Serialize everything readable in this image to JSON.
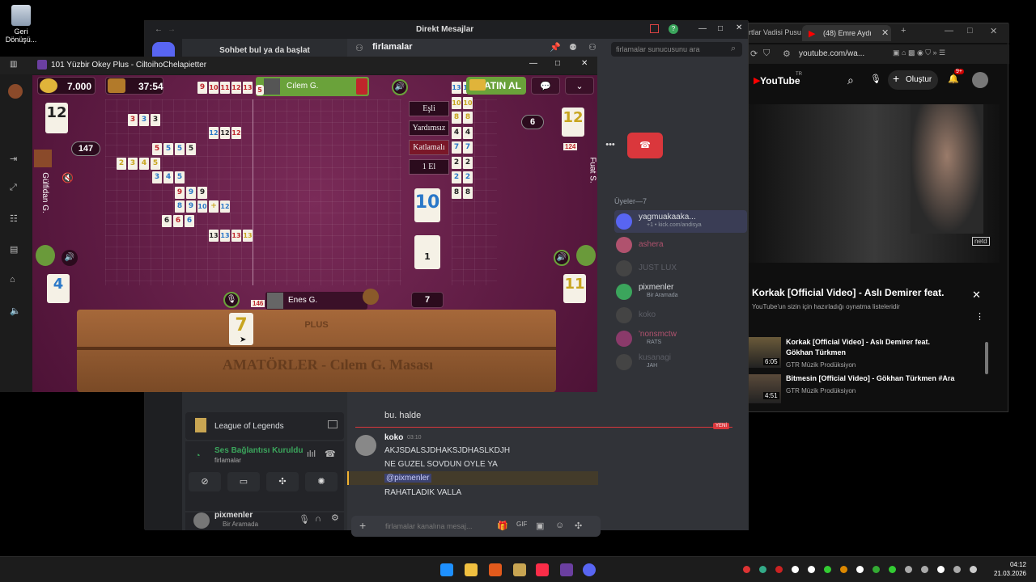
{
  "desktop": {
    "recycle_bin_label": "Geri Dönüşü..."
  },
  "discord": {
    "title": "Direkt Mesajlar",
    "find_conversation": "Sohbet bul ya da başlat",
    "channel_name": "firlamalar",
    "search_placeholder": "firlamalar sunucusunu ara",
    "members_header": "Üyeler—7",
    "members": [
      {
        "name": "yagmuakaaka...",
        "status": "+1 • kick.com/andisya",
        "color": "#dbdee1"
      },
      {
        "name": "ashera",
        "status": "",
        "color": "#b0526e"
      },
      {
        "name": "JUST LUX",
        "status": "",
        "color": "#5c5e66"
      },
      {
        "name": "pixmenler",
        "status": "Bir Aramada",
        "color": "#dbdee1"
      },
      {
        "name": "koko",
        "status": "",
        "color": "#5c5e66"
      },
      {
        "name": "'nonsmctw",
        "status": "RATS",
        "color": "#b0526e"
      },
      {
        "name": "kusanagi",
        "status": "JAH",
        "color": "#5c5e66"
      }
    ],
    "messages": [
      {
        "author": "",
        "time": "",
        "text": "bu. halde"
      },
      {
        "author": "koko",
        "time": "03:10",
        "text": "AKJSDALSJDHAKSJDHASLKDJH"
      },
      {
        "author": "",
        "time": "",
        "text": "NE GUZEL SOVDUN OYLE YA"
      },
      {
        "author": "",
        "time": "",
        "text": "@pixmenler"
      },
      {
        "author": "",
        "time": "",
        "text": "RAHATLADIK VALLA"
      }
    ],
    "new_badge": "YENİ",
    "activity_game": "League of Legends",
    "voice_status": "Ses Bağlantısı Kuruldu",
    "voice_channel": "firlamalar",
    "user_name": "pixmenler",
    "user_status": "Bir Aramada",
    "composer_placeholder": "firlamalar kanalına mesaj..."
  },
  "youtube": {
    "tab1": "rtlar Vadisi Pusu",
    "tab2": "(48) Emre Aydı",
    "url": "youtube.com/wa...",
    "create_label": "Oluştur",
    "notif_count": "9+",
    "logo": "YouTube",
    "logo_sup": "TR",
    "video_watermark": "netd",
    "playlist_title": "Korkak [Official Video] - Aslı Demirer feat.",
    "playlist_sub": "YouTube'un sizin için hazırladığı oynatma listeleridir",
    "items": [
      {
        "title": "Korkak [Official Video] - Aslı Demirer feat. Gökhan Türkmen",
        "channel": "GTR Müzik Prodüksiyon",
        "duration": "6:05"
      },
      {
        "title": "Bitmesin [Official Video] - Gökhan Türkmen #Ara",
        "channel": "GTR Müzik Prodüksiyon",
        "duration": "4:51"
      }
    ]
  },
  "game": {
    "window_title": "101 Yüzbir Okey Plus - CiltoihoChelapietter",
    "gold": "7.000",
    "chest": "37:54",
    "top_player": "Cılem G.",
    "top_player_tile": "5",
    "buy_label": "SATIN AL",
    "left_player": "Gülfidan G.",
    "right_player": "Fuat S.",
    "bottom_player": "Enes G.",
    "bottom_player_tiles": "146",
    "right_player_tiles": "124",
    "left_score_top": "12",
    "left_score_mid": "147",
    "left_score_bottom": "4",
    "right_score_top": "12",
    "right_score_mid": "6",
    "right_score_bottom": "11",
    "center_tile": "10",
    "deck_count": "1",
    "discard_count": "7",
    "rack_tile": "7",
    "options": [
      "Eşli",
      "Yardımsız",
      "Katlamalı",
      "1 El"
    ],
    "rack_watermark": "AMATÖRLER - Cılem G. Masası",
    "rack_logo": "PLUS",
    "melds": [
      [
        {
          "v": "9",
          "c": "r"
        },
        {
          "v": "10",
          "c": "r"
        },
        {
          "v": "11",
          "c": "r"
        },
        {
          "v": "12",
          "c": "r"
        },
        {
          "v": "13",
          "c": "r"
        }
      ],
      [
        {
          "v": "3",
          "c": "r"
        },
        {
          "v": "3",
          "c": "b"
        },
        {
          "v": "3",
          "c": "k"
        }
      ],
      [
        {
          "v": "12",
          "c": "b"
        },
        {
          "v": "12",
          "c": "k"
        },
        {
          "v": "12",
          "c": "r"
        }
      ],
      [
        {
          "v": "5",
          "c": "r"
        },
        {
          "v": "5",
          "c": "b"
        },
        {
          "v": "5",
          "c": "b"
        },
        {
          "v": "5",
          "c": "k"
        }
      ],
      [
        {
          "v": "2",
          "c": "y"
        },
        {
          "v": "3",
          "c": "y"
        },
        {
          "v": "4",
          "c": "y"
        },
        {
          "v": "5",
          "c": "y"
        }
      ],
      [
        {
          "v": "3",
          "c": "b"
        },
        {
          "v": "4",
          "c": "b"
        },
        {
          "v": "5",
          "c": "b"
        }
      ],
      [
        {
          "v": "9",
          "c": "r"
        },
        {
          "v": "9",
          "c": "b"
        },
        {
          "v": "9",
          "c": "k"
        }
      ],
      [
        {
          "v": "8",
          "c": "b"
        },
        {
          "v": "9",
          "c": "b"
        },
        {
          "v": "10",
          "c": "b"
        },
        {
          "v": "+",
          "c": "y"
        },
        {
          "v": "12",
          "c": "b"
        }
      ],
      [
        {
          "v": "6",
          "c": "k"
        },
        {
          "v": "6",
          "c": "r"
        },
        {
          "v": "6",
          "c": "b"
        }
      ],
      [
        {
          "v": "13",
          "c": "k"
        },
        {
          "v": "13",
          "c": "b"
        },
        {
          "v": "13",
          "c": "r"
        },
        {
          "v": "13",
          "c": "y"
        }
      ]
    ],
    "right_melds": [
      [
        {
          "v": "13",
          "c": "b"
        },
        {
          "v": "13",
          "c": "b"
        }
      ],
      [
        {
          "v": "10",
          "c": "y"
        },
        {
          "v": "10",
          "c": "y"
        }
      ],
      [
        {
          "v": "8",
          "c": "y"
        },
        {
          "v": "8",
          "c": "y"
        }
      ],
      [
        {
          "v": "4",
          "c": "k"
        },
        {
          "v": "4",
          "c": "k"
        }
      ],
      [
        {
          "v": "7",
          "c": "b"
        },
        {
          "v": "7",
          "c": "b"
        }
      ],
      [
        {
          "v": "2",
          "c": "k"
        },
        {
          "v": "2",
          "c": "k"
        }
      ],
      [
        {
          "v": "2",
          "c": "b"
        },
        {
          "v": "2",
          "c": "b"
        }
      ],
      [
        {
          "v": "8",
          "c": "k"
        },
        {
          "v": "8",
          "c": "k"
        }
      ]
    ]
  },
  "taskbar": {
    "time": "04:12",
    "date": "21.03.2026"
  }
}
